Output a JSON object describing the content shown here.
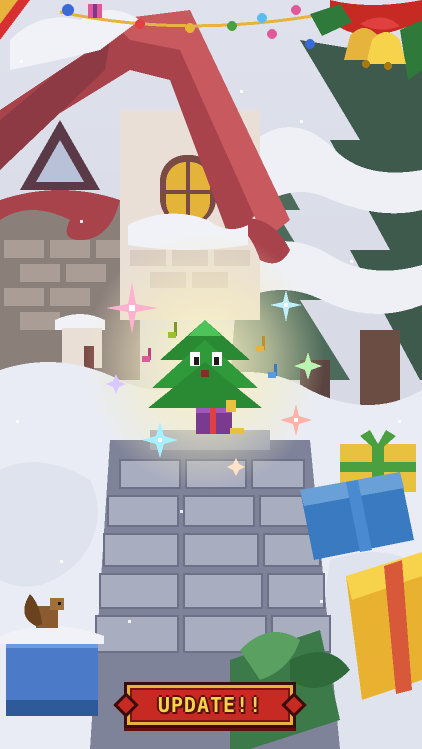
{
  "game": {
    "update_button_label": "UPDATE!!"
  },
  "colors": {
    "snow": "#e9ecf4",
    "roof": "#a8434c",
    "wall": "#eadfd6",
    "path_stone": "#9b9fb4",
    "tree_green": "#2f9a3a",
    "pot_purple": "#7a3a8f",
    "button_red": "#c62a23",
    "button_text": "#f6d34a"
  },
  "icons": [
    "christmas-tree-character",
    "sparkle-icon",
    "music-note-icon",
    "bell-decoration",
    "gift-box",
    "squirrel"
  ]
}
